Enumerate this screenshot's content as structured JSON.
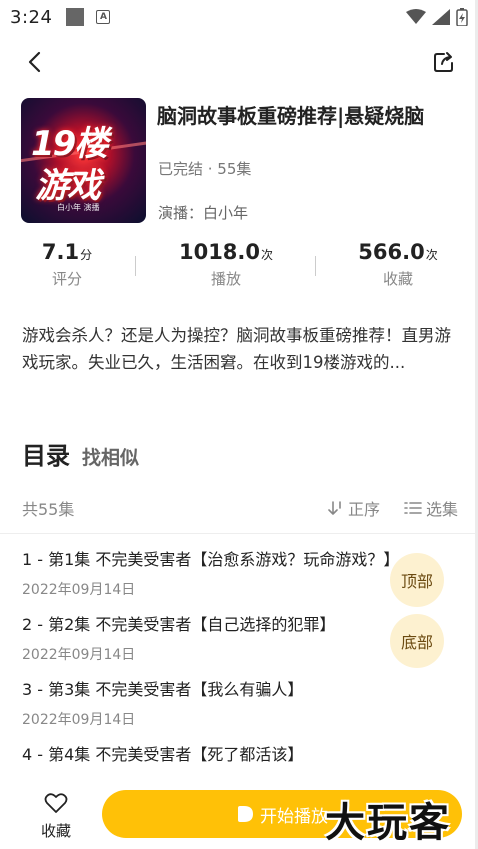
{
  "status_bar": {
    "time": "3:24",
    "app_badge": "A"
  },
  "album": {
    "cover": {
      "line1": "19楼",
      "line2": "游戏",
      "credit": "白小年 演播"
    },
    "title": "脑洞故事板重磅推荐|悬疑烧脑",
    "meta": "已完结 · 55集",
    "anchor": "演播：白小年"
  },
  "stats": [
    {
      "value": "7.1",
      "unit": "分",
      "label": "评分"
    },
    {
      "value": "1018.0",
      "unit": "次",
      "label": "播放"
    },
    {
      "value": "566.0",
      "unit": "次",
      "label": "收藏"
    }
  ],
  "description": "游戏会杀人？还是人为操控？脑洞故事板重磅推荐！直男游戏玩家。失业已久，生活困窘。在收到19楼游戏的...",
  "catalog": {
    "title": "目录",
    "similar": "找相似",
    "count": "共55集",
    "sort_label": "正序",
    "select_label": "选集"
  },
  "episodes": [
    {
      "title": "1 - 第1集 不完美受害者【治愈系游戏？玩命游戏？】",
      "date": "2022年09月14日"
    },
    {
      "title": "2 - 第2集 不完美受害者【自己选择的犯罪】",
      "date": "2022年09月14日"
    },
    {
      "title": "3 - 第3集 不完美受害者【我么有骗人】",
      "date": "2022年09月14日"
    },
    {
      "title": "4 - 第4集 不完美受害者【死了都活该】",
      "date": ""
    }
  ],
  "float_buttons": {
    "top": "顶部",
    "bottom": "底部"
  },
  "bottom_bar": {
    "favorite_label": "收藏",
    "play_label": "开始播放"
  },
  "watermark": "大玩客",
  "colors": {
    "accent": "#ffc107",
    "float_bg": "#fdf1d0"
  },
  "icons": {
    "back": "back-arrow-icon",
    "share": "share-icon",
    "sort": "sort-icon",
    "select": "list-icon",
    "favorite": "heart-icon",
    "play": "play-icon"
  }
}
